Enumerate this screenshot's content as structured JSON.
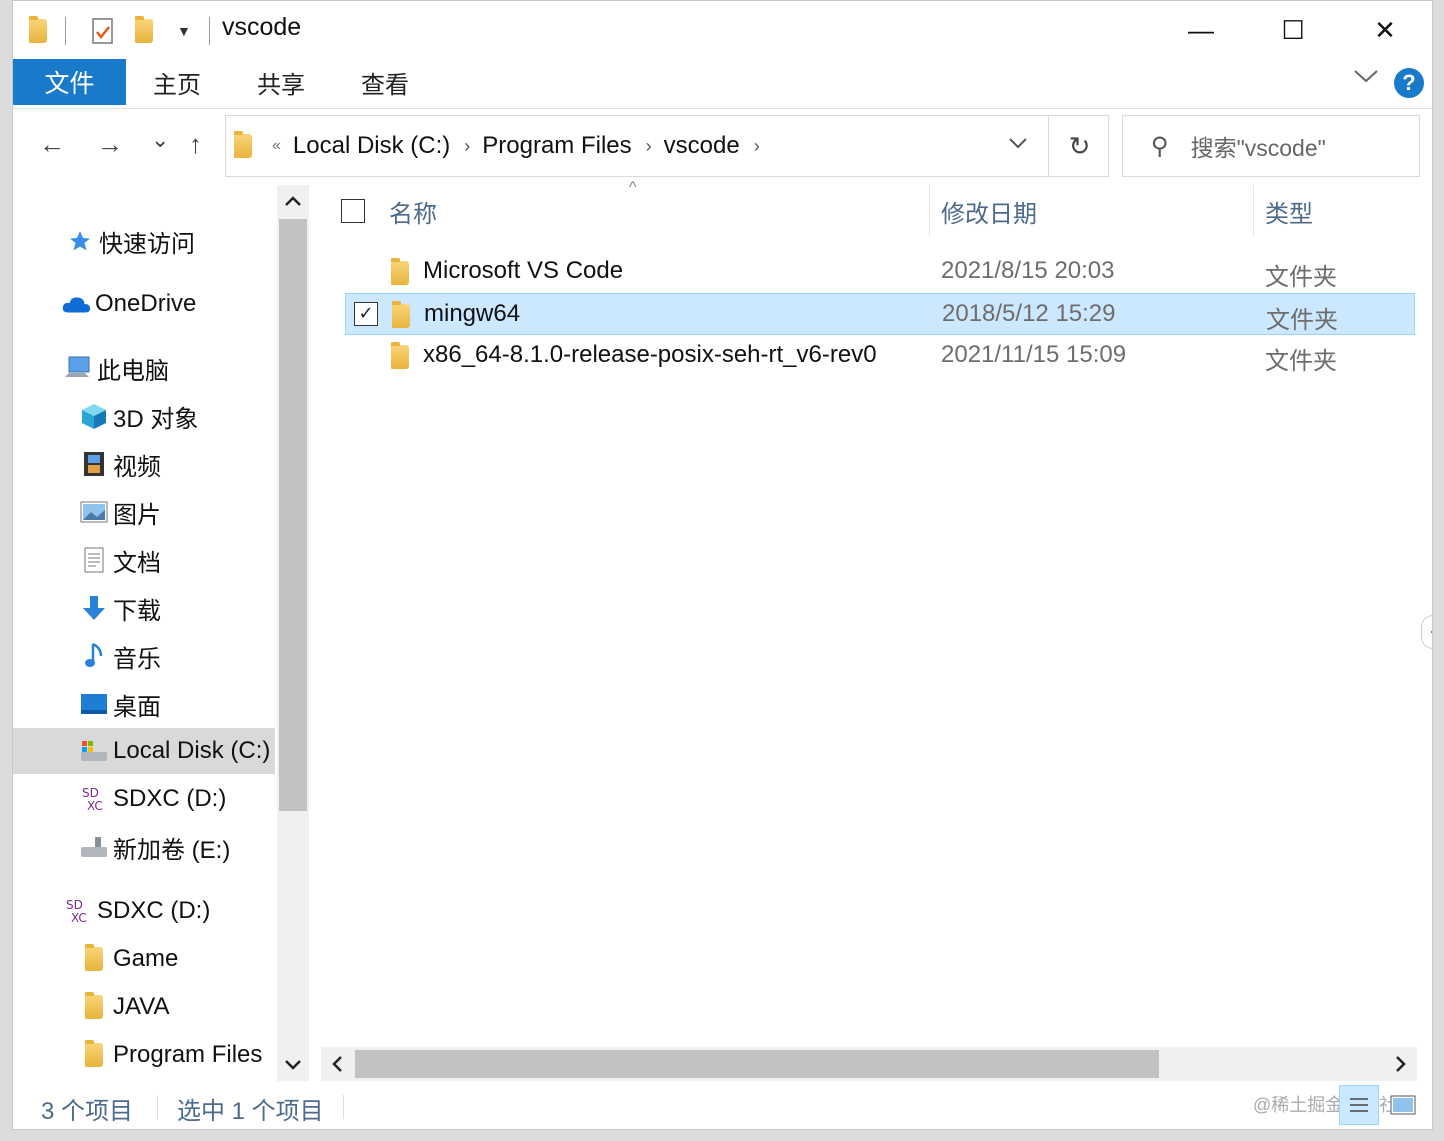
{
  "window": {
    "title": "vscode",
    "controls": {
      "minimize": "—",
      "maximize": "☐",
      "close": "✕"
    }
  },
  "ribbon": {
    "tabs": [
      {
        "label": "文件",
        "active": true
      },
      {
        "label": "主页"
      },
      {
        "label": "共享"
      },
      {
        "label": "查看"
      }
    ],
    "help": "?"
  },
  "navbar": {
    "back": "←",
    "forward": "→",
    "recent": "⌄",
    "up": "↑",
    "crumbs": [
      "Local Disk (C:)",
      "Program Files",
      "vscode"
    ],
    "overflow": "«",
    "refresh": "↻",
    "search_placeholder": "搜索\"vscode\""
  },
  "nav_pane": {
    "items": [
      {
        "label": "快速访问",
        "icon": "star-icon"
      },
      {
        "label": "OneDrive",
        "icon": "cloud-icon"
      },
      {
        "label": "此电脑",
        "icon": "computer-icon"
      },
      {
        "label": "3D 对象",
        "icon": "cube-icon"
      },
      {
        "label": "视频",
        "icon": "film-icon"
      },
      {
        "label": "图片",
        "icon": "picture-icon"
      },
      {
        "label": "文档",
        "icon": "document-icon"
      },
      {
        "label": "下载",
        "icon": "download-icon"
      },
      {
        "label": "音乐",
        "icon": "music-icon"
      },
      {
        "label": "桌面",
        "icon": "desktop-icon"
      },
      {
        "label": "Local Disk (C:)",
        "icon": "drive-icon",
        "selected": true
      },
      {
        "label": "SDXC (D:)",
        "icon": "sd-card-icon"
      },
      {
        "label": "新加卷 (E:)",
        "icon": "drive-icon"
      },
      {
        "label": "SDXC (D:)",
        "icon": "sd-card-icon"
      },
      {
        "label": "Game",
        "icon": "folder-icon"
      },
      {
        "label": "JAVA",
        "icon": "folder-icon"
      },
      {
        "label": "Program Files",
        "icon": "folder-icon"
      }
    ]
  },
  "columns": {
    "name": "名称",
    "date": "修改日期",
    "type": "类型"
  },
  "files": [
    {
      "name": "Microsoft VS Code",
      "date": "2021/8/15 20:03",
      "type": "文件夹",
      "selected": false
    },
    {
      "name": "mingw64",
      "date": "2018/5/12 15:29",
      "type": "文件夹",
      "selected": true
    },
    {
      "name": "x86_64-8.1.0-release-posix-seh-rt_v6-rev0",
      "date": "2021/11/15 15:09",
      "type": "文件夹",
      "selected": false
    }
  ],
  "status": {
    "count": "3 个项目",
    "selected": "选中 1 个项目"
  },
  "watermark": "@稀土掘金技术社区",
  "colors": {
    "accent": "#1979ca",
    "selection": "#cce8ff",
    "header_text": "#4d6a8a"
  }
}
